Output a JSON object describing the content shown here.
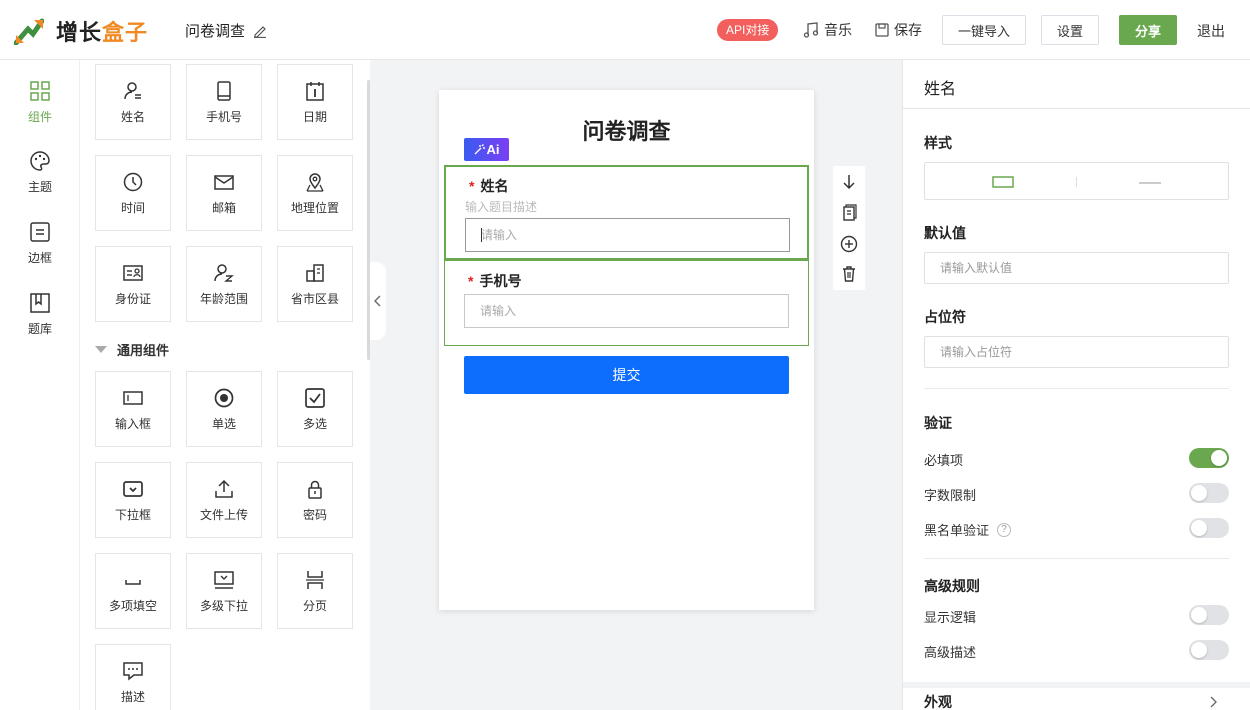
{
  "header": {
    "logo_part1": "增长",
    "logo_part2": "盒子",
    "doc_title": "问卷调查",
    "api_badge": "API对接",
    "music_label": "音乐",
    "save_label": "保存",
    "import_label": "一键导入",
    "settings_label": "设置",
    "share_label": "分享",
    "logout_label": "退出"
  },
  "leftnav": {
    "items": [
      {
        "label": "组件",
        "icon": "grid-icon",
        "active": true
      },
      {
        "label": "主题",
        "icon": "palette-icon"
      },
      {
        "label": "边框",
        "icon": "border-icon"
      },
      {
        "label": "题库",
        "icon": "library-icon"
      }
    ]
  },
  "components": {
    "preset": [
      {
        "label": "姓名",
        "icon": "person-icon"
      },
      {
        "label": "手机号",
        "icon": "phone-icon"
      },
      {
        "label": "日期",
        "icon": "calendar-icon"
      },
      {
        "label": "时间",
        "icon": "clock-icon"
      },
      {
        "label": "邮箱",
        "icon": "mail-icon"
      },
      {
        "label": "地理位置",
        "icon": "location-icon"
      },
      {
        "label": "身份证",
        "icon": "id-card-icon"
      },
      {
        "label": "年龄范围",
        "icon": "age-icon"
      },
      {
        "label": "省市区县",
        "icon": "building-icon"
      }
    ],
    "general_title": "通用组件",
    "general": [
      {
        "label": "输入框",
        "icon": "input-icon"
      },
      {
        "label": "单选",
        "icon": "radio-icon"
      },
      {
        "label": "多选",
        "icon": "checkbox-icon"
      },
      {
        "label": "下拉框",
        "icon": "dropdown-icon"
      },
      {
        "label": "文件上传",
        "icon": "upload-icon"
      },
      {
        "label": "密码",
        "icon": "lock-icon"
      },
      {
        "label": "多项填空",
        "icon": "blank-icon"
      },
      {
        "label": "多级下拉",
        "icon": "multi-dropdown-icon"
      },
      {
        "label": "分页",
        "icon": "pagination-icon"
      },
      {
        "label": "描述",
        "icon": "comment-icon"
      }
    ]
  },
  "form": {
    "title": "问卷调查",
    "ai_badge": "Ai",
    "fields": [
      {
        "label": "姓名",
        "required": "*",
        "description": "输入题目描述",
        "placeholder": "请输入"
      },
      {
        "label": "手机号",
        "required": "*",
        "placeholder": "请输入"
      }
    ],
    "submit_label": "提交"
  },
  "right_panel": {
    "title": "姓名",
    "style_label": "样式",
    "default_label": "默认值",
    "default_placeholder": "请输入默认值",
    "placeholder_label": "占位符",
    "placeholder_placeholder": "请输入占位符",
    "validation_label": "验证",
    "required_label": "必填项",
    "required_on": true,
    "length_label": "字数限制",
    "length_on": false,
    "blacklist_label": "黑名单验证",
    "blacklist_on": false,
    "advanced_label": "高级规则",
    "logic_label": "显示逻辑",
    "logic_on": false,
    "adv_desc_label": "高级描述",
    "adv_desc_on": false,
    "appearance_label": "外观"
  },
  "colors": {
    "accent_green": "#6aa84f",
    "primary_blue": "#0d6efd",
    "api_red": "#f25f5c",
    "logo_orange": "#f08a24"
  }
}
